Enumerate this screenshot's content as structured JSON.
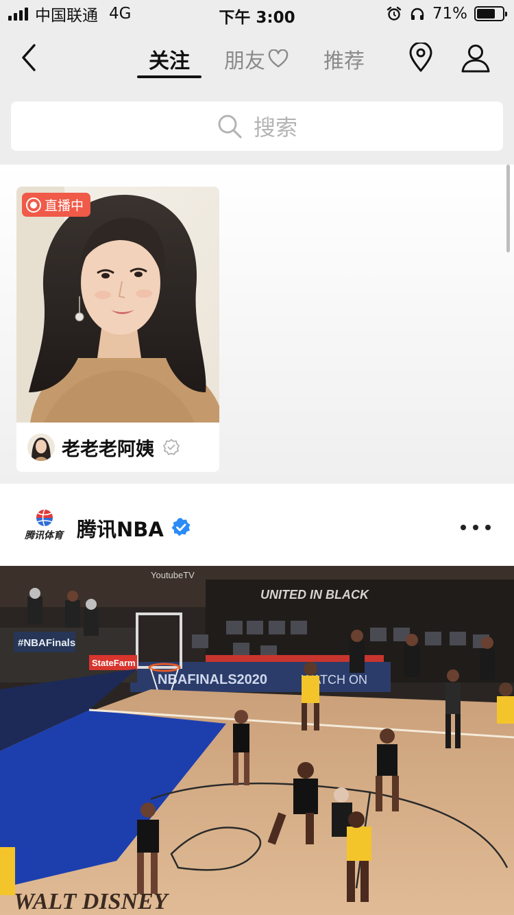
{
  "status_bar": {
    "carrier": "中国联通",
    "network": "4G",
    "time": "下午 3:00",
    "battery_percent": "71%",
    "battery_level": 0.71
  },
  "nav": {
    "tabs": [
      {
        "label": "关注",
        "active": true
      },
      {
        "label": "朋友",
        "active": false
      },
      {
        "label": "推荐",
        "active": false
      }
    ]
  },
  "search": {
    "placeholder": "搜索"
  },
  "live": {
    "badge": "直播中",
    "name": "老老老阿姨"
  },
  "post": {
    "logo_text": "腾讯体育",
    "author": "腾讯NBA",
    "media": {
      "banner_left": "#NBAFinals",
      "banner_statefarm": "StateFarm",
      "banner_finals": "NBAFINALS2020",
      "banner_youtube": "YoutubeTV",
      "banner_watch": "WATCH ON",
      "banner_black": "UNITED IN BLACK",
      "court_logo": "WALT DISNEY"
    }
  },
  "colors": {
    "live_badge": "#f05a48",
    "verify_blue": "#2b8cf6",
    "accent": "#111111"
  }
}
